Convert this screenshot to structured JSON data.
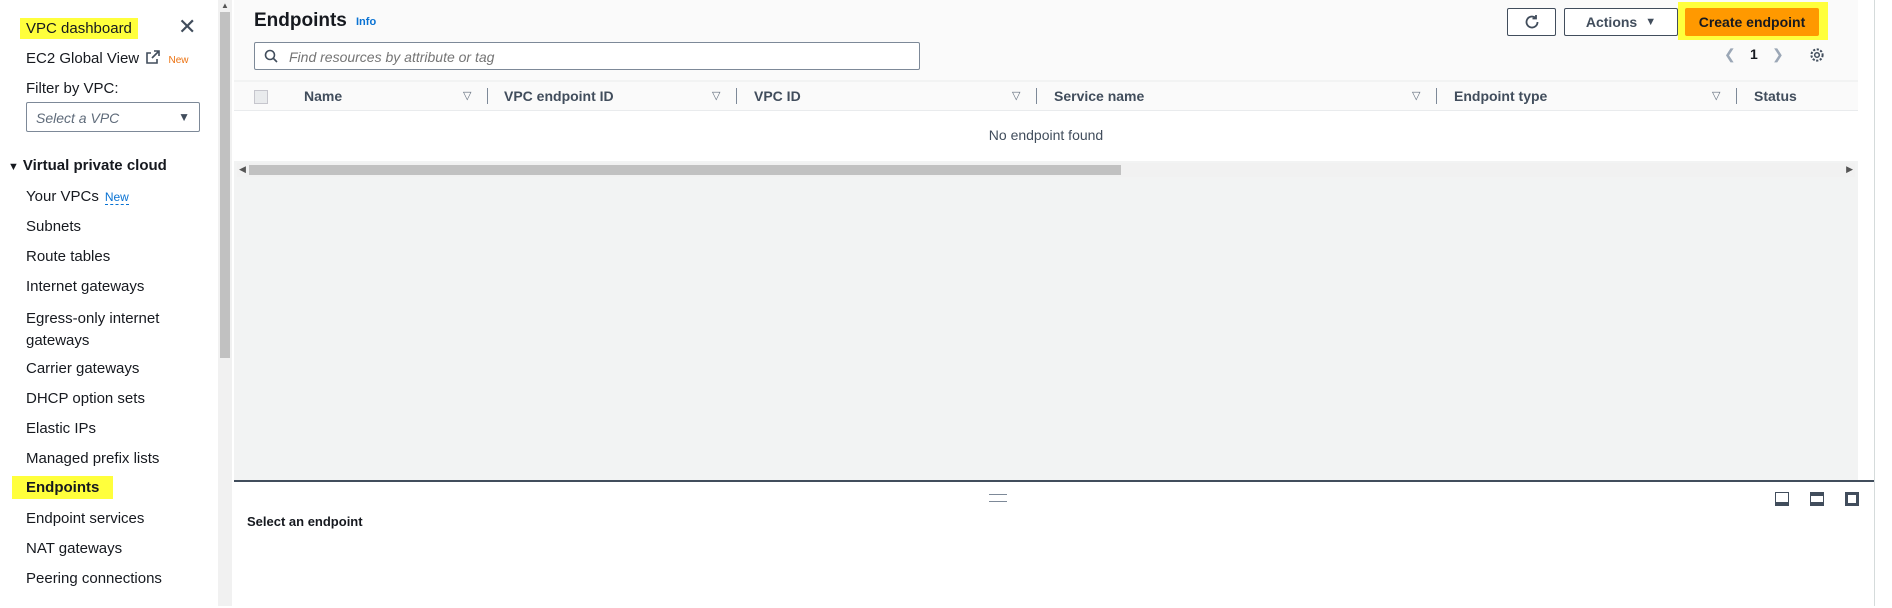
{
  "sidebar": {
    "title": "VPC dashboard",
    "global_view": "EC2 Global View",
    "global_view_badge": "New",
    "filter_label": "Filter by VPC:",
    "filter_placeholder": "Select a VPC",
    "section": "Virtual private cloud",
    "items": [
      {
        "label": "Your VPCs",
        "badge": "New"
      },
      {
        "label": "Subnets"
      },
      {
        "label": "Route tables"
      },
      {
        "label": "Internet gateways"
      },
      {
        "label": "Egress-only internet gateways"
      },
      {
        "label": "Carrier gateways"
      },
      {
        "label": "DHCP option sets"
      },
      {
        "label": "Elastic IPs"
      },
      {
        "label": "Managed prefix lists"
      },
      {
        "label": "Endpoints",
        "active": true
      },
      {
        "label": "Endpoint services"
      },
      {
        "label": "NAT gateways"
      },
      {
        "label": "Peering connections"
      }
    ]
  },
  "header": {
    "title": "Endpoints",
    "info": "Info",
    "actions": "Actions",
    "create": "Create endpoint",
    "search_placeholder": "Find resources by attribute or tag",
    "page": "1"
  },
  "table": {
    "columns": [
      "Name",
      "VPC endpoint ID",
      "VPC ID",
      "Service name",
      "Endpoint type",
      "Status"
    ],
    "empty": "No endpoint found"
  },
  "split_panel": {
    "title": "Select an endpoint"
  },
  "colors": {
    "primary": "#ff9900",
    "highlight": "#ffff3c",
    "link": "#0972d3"
  }
}
